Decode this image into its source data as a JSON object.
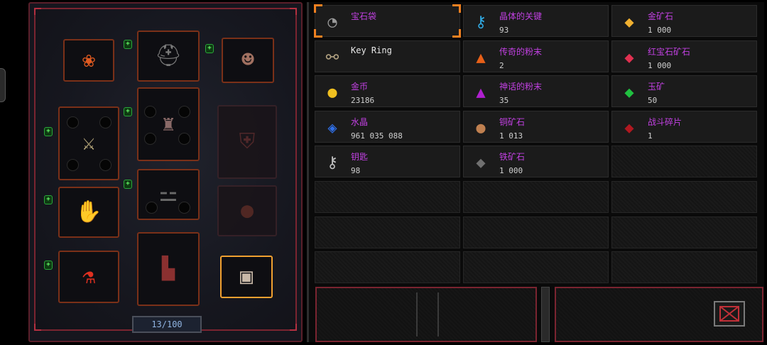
{
  "equipment": {
    "capacity_label": "13/100",
    "slots": [
      {
        "name": "amulet-slot",
        "icon": "amulet-icon",
        "glyph": "❀",
        "color": "#e05a20"
      },
      {
        "name": "helmet-slot",
        "icon": "helmet-icon",
        "glyph": "⛑",
        "color": "#7a7a7a"
      },
      {
        "name": "mask-slot",
        "icon": "mask-icon",
        "glyph": "☻",
        "color": "#a07060"
      },
      {
        "name": "weapon-slot",
        "icon": "weapon-icon",
        "glyph": "⚔",
        "color": "#c0b080"
      },
      {
        "name": "chest-armor-slot",
        "icon": "chest-armor-icon",
        "glyph": "♜",
        "color": "#8a6a68"
      },
      {
        "name": "shield-slot",
        "icon": "shield-icon",
        "glyph": "⛨",
        "color": "#5a2a2a"
      },
      {
        "name": "gloves-slot",
        "icon": "gloves-icon",
        "glyph": "✋",
        "color": "#4a80e0"
      },
      {
        "name": "belt-slot",
        "icon": "belt-icon",
        "glyph": "⚍",
        "color": "#6a6a6a"
      },
      {
        "name": "ring-slot",
        "icon": "ring-icon",
        "glyph": "●",
        "color": "#5a2a24"
      },
      {
        "name": "potion-slot",
        "icon": "potion-icon",
        "glyph": "⚗",
        "color": "#e03020"
      },
      {
        "name": "boots-slot",
        "icon": "boots-icon",
        "glyph": "▙",
        "color": "#8a3030"
      },
      {
        "name": "chest-slot",
        "icon": "treasure-chest-icon",
        "glyph": "▣",
        "color": "#c8b8a8"
      }
    ]
  },
  "inventory": {
    "items": [
      {
        "name": "宝石袋",
        "count": "",
        "icon": "gem-bag-icon",
        "glyph": "◔",
        "color": "#9a9a9a",
        "white": false
      },
      {
        "name": "晶体的关键",
        "count": "93",
        "icon": "crystal-key-icon",
        "glyph": "⚷",
        "color": "#30a8e0",
        "white": false
      },
      {
        "name": "金矿石",
        "count": "1 000",
        "icon": "gold-ore-icon",
        "glyph": "◆",
        "color": "#f0b030",
        "white": false
      },
      {
        "name": "Key Ring",
        "count": "",
        "icon": "key-ring-icon",
        "glyph": "⚯",
        "color": "#b0a080",
        "white": true
      },
      {
        "name": "传奇的粉末",
        "count": "2",
        "icon": "legendary-powder-icon",
        "glyph": "▲",
        "color": "#e86018",
        "white": false
      },
      {
        "name": "红宝石矿石",
        "count": "1 000",
        "icon": "ruby-ore-icon",
        "glyph": "◆",
        "color": "#e03050",
        "white": false
      },
      {
        "name": "金币",
        "count": "23186",
        "icon": "gold-coins-icon",
        "glyph": "●",
        "color": "#f0c020",
        "white": false
      },
      {
        "name": "神话的粉末",
        "count": "35",
        "icon": "mythic-powder-icon",
        "glyph": "▲",
        "color": "#b020d0",
        "white": false
      },
      {
        "name": "玉矿",
        "count": "50",
        "icon": "jade-ore-icon",
        "glyph": "◆",
        "color": "#20c040",
        "white": false
      },
      {
        "name": "水晶",
        "count": "961 035 088",
        "icon": "crystal-icon",
        "glyph": "◈",
        "color": "#3070e8",
        "white": false
      },
      {
        "name": "铜矿石",
        "count": "1 013",
        "icon": "copper-ore-icon",
        "glyph": "●",
        "color": "#c08050",
        "white": false
      },
      {
        "name": "战斗碎片",
        "count": "1",
        "icon": "battle-shard-icon",
        "glyph": "◆",
        "color": "#b01820",
        "white": false
      },
      {
        "name": "钥匙",
        "count": "98",
        "icon": "key-icon",
        "glyph": "⚷",
        "color": "#c0c0c0",
        "white": false
      },
      {
        "name": "铁矿石",
        "count": "1 000",
        "icon": "iron-ore-icon",
        "glyph": "◆",
        "color": "#707070",
        "white": false
      }
    ]
  }
}
